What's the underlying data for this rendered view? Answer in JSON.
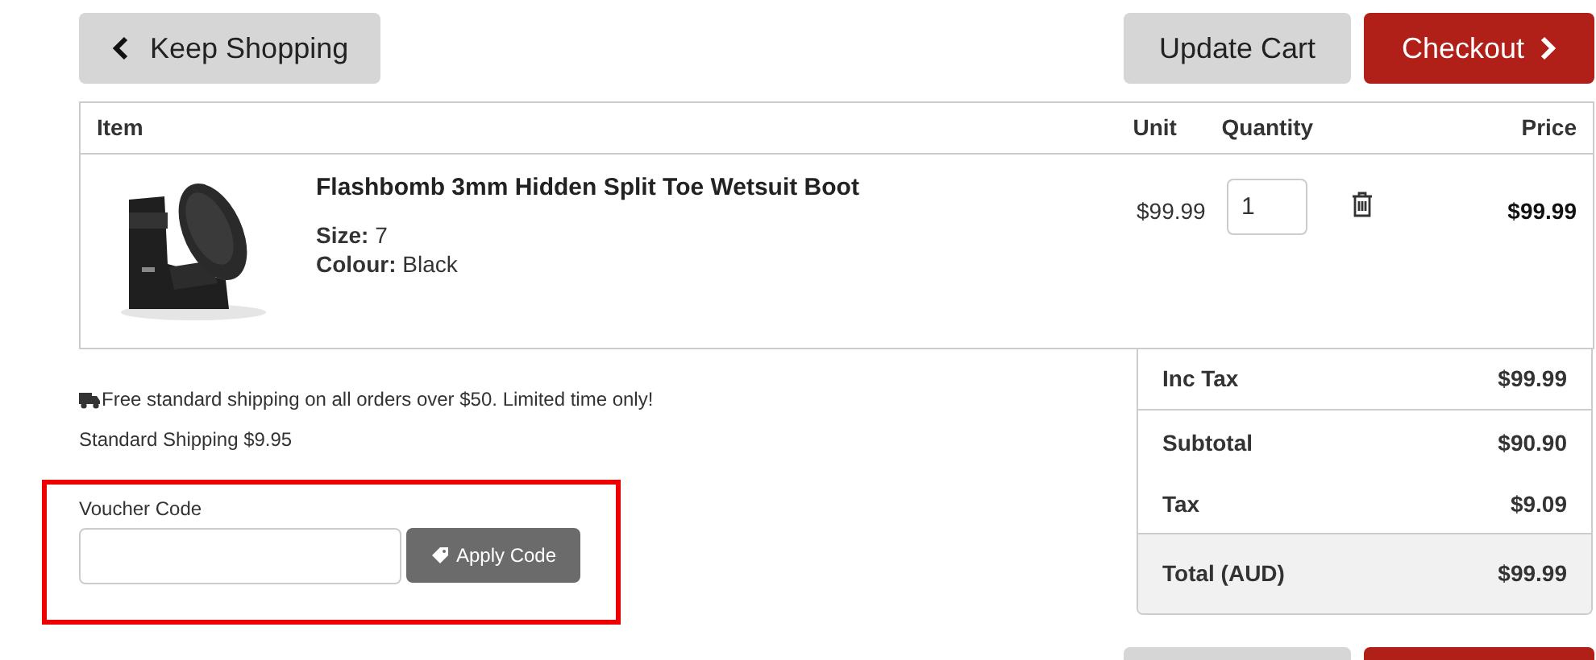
{
  "top_actions": {
    "keep_shopping": "Keep Shopping",
    "update_cart": "Update Cart",
    "checkout": "Checkout"
  },
  "table": {
    "columns": [
      "Item",
      "Unit",
      "Quantity",
      "Price"
    ],
    "rows": [
      {
        "kind": "picture",
        "name": "Flashbomb 3mm Hidden Split Toe Wetsuit Boot",
        "details": [
          "**Size:** 7",
          "**Colour:** Black"
        ],
        "unit": "$99.99",
        "quantity": "1",
        "price": "$99.99"
      }
    ]
  },
  "shipping": {
    "promo": "Free standard shipping on all orders over $50. Limited time only!",
    "standard": "Standard Shipping $9.95"
  },
  "voucher": {
    "label": "Voucher Code",
    "button": "Apply Code",
    "highlighted": true
  },
  "totals": [
    {
      "label": "Inc Tax",
      "value": "$99.99",
      "kind": "inc"
    },
    {
      "label": "Subtotal",
      "value": "$90.90",
      "kind": "sub"
    },
    {
      "label": "Tax",
      "value": "$9.09",
      "kind": "tax"
    },
    {
      "label": "Total (AUD)",
      "value": "$99.99",
      "kind": "total"
    }
  ]
}
